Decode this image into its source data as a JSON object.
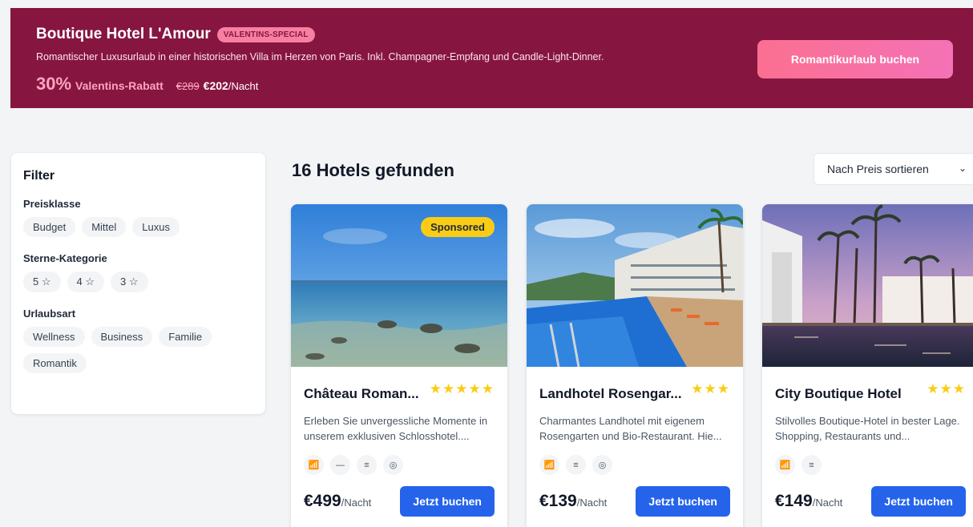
{
  "banner": {
    "title": "Boutique Hotel L'Amour",
    "badge": "VALENTINS-SPECIAL",
    "description": "Romantischer Luxusurlaub in einer historischen Villa im Herzen von Paris. Inkl. Champagner-Empfang und Candle-Light-Dinner.",
    "discount_percent": "30%",
    "discount_label": "Valentins-Rabatt",
    "old_price": "€289",
    "new_price": "€202",
    "price_unit": "/Nacht",
    "cta_label": "Romantikurlaub buchen"
  },
  "filter": {
    "title": "Filter",
    "groups": [
      {
        "label": "Preisklasse",
        "options": [
          "Budget",
          "Mittel",
          "Luxus"
        ]
      },
      {
        "label": "Sterne-Kategorie",
        "options": [
          "5 ☆",
          "4 ☆",
          "3 ☆"
        ]
      },
      {
        "label": "Urlaubsart",
        "options": [
          "Wellness",
          "Business",
          "Familie",
          "Romantik"
        ]
      }
    ]
  },
  "results": {
    "title": "16 Hotels gefunden",
    "sort_label": "Nach Preis sortieren"
  },
  "hotels": [
    {
      "name": "Château Roman...",
      "stars": "★★★★★",
      "sponsored": "Sponsored",
      "description": "Erleben Sie unvergessliche Momente in unserem exklusiven Schlosshotel....",
      "amenities": [
        "wifi-icon",
        "spa-icon",
        "restaurant-icon",
        "parking-icon"
      ],
      "price": "€499",
      "price_unit": "/Nacht",
      "cta": "Jetzt buchen"
    },
    {
      "name": "Landhotel Rosengar...",
      "stars": "★★★",
      "description": "Charmantes Landhotel mit eigenem Rosengarten und Bio-Restaurant. Hie...",
      "amenities": [
        "wifi-icon",
        "restaurant-icon",
        "parking-icon"
      ],
      "price": "€139",
      "price_unit": "/Nacht",
      "cta": "Jetzt buchen"
    },
    {
      "name": "City Boutique Hotel",
      "stars": "★★★",
      "description": "Stilvolles Boutique-Hotel in bester Lage. Shopping, Restaurants und...",
      "amenities": [
        "wifi-icon",
        "restaurant-icon"
      ],
      "price": "€149",
      "price_unit": "/Nacht",
      "cta": "Jetzt buchen"
    }
  ]
}
